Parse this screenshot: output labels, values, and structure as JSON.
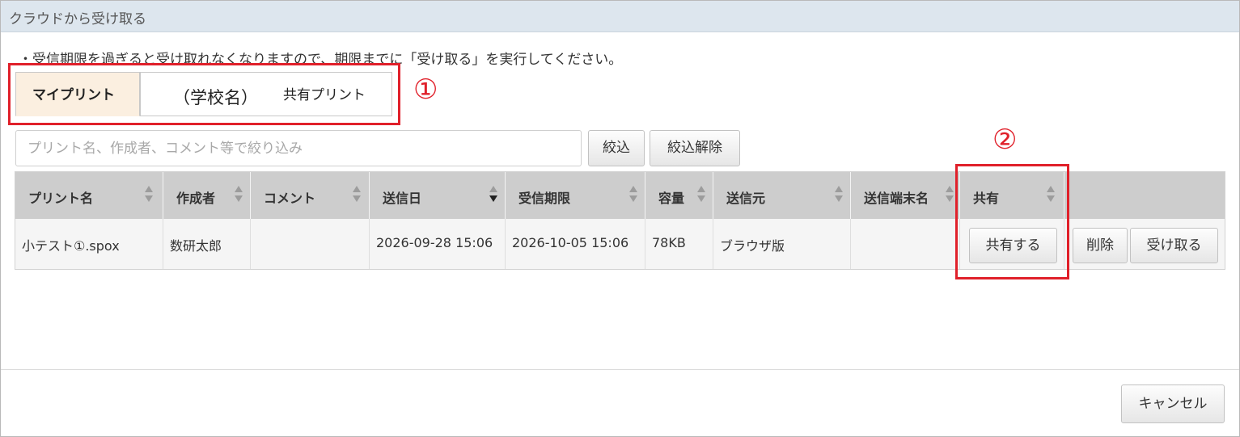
{
  "dialog": {
    "title": "クラウドから受け取る",
    "notice": "・受信期限を過ぎると受け取れなくなりますので、期限までに「受け取る」を実行してください。"
  },
  "tabs": {
    "my_print": "マイプリント",
    "school_name": "（学校名）",
    "shared_print": "共有プリント",
    "active": "my_print"
  },
  "annotations": {
    "marker1": "①",
    "marker2": "②",
    "color": "#e0202a"
  },
  "filter": {
    "placeholder": "プリント名、作成者、コメント等で絞り込み",
    "value": "",
    "filter_button": "絞込",
    "clear_button": "絞込解除"
  },
  "table": {
    "columns": [
      "プリント名",
      "作成者",
      "コメント",
      "送信日",
      "受信期限",
      "容量",
      "送信元",
      "送信端末名",
      "共有"
    ],
    "sorted_column": "送信日",
    "sort_direction": "descending",
    "rows": [
      {
        "print_name": "小テスト①.spox",
        "author": "数研太郎",
        "comment": "",
        "sent_date": "2026-09-28 15:06",
        "deadline": "2026-10-05 15:06",
        "size": "78KB",
        "source": "ブラウザ版",
        "device": "",
        "share_button": "共有する",
        "delete_button": "削除",
        "receive_button": "受け取る"
      }
    ]
  },
  "footer": {
    "cancel_button": "キャンセル"
  },
  "colors": {
    "titlebar": "#dde6ee",
    "active_tab": "#fbefe0",
    "header": "#cdcdcd",
    "highlight": "#e0202a"
  }
}
